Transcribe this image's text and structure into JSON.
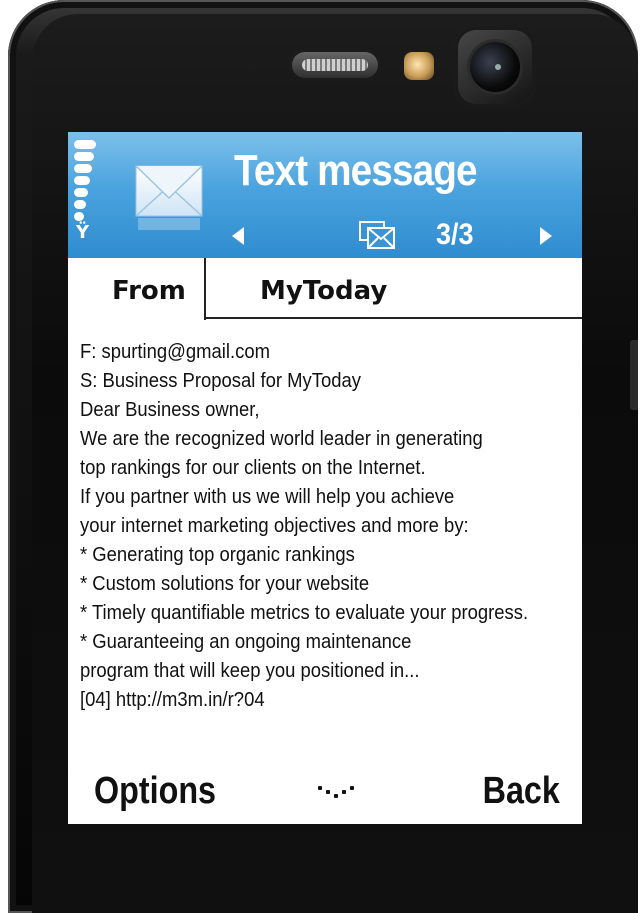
{
  "header": {
    "title": "Text message",
    "counter": "3/3"
  },
  "from_row": {
    "label": "From",
    "value": "MyToday"
  },
  "message": {
    "lines": [
      "F: spurting@gmail.com",
      "S: Business Proposal for MyToday",
      "Dear Business owner,",
      "We are the recognized world leader in generating",
      "top rankings for our clients on the Internet.",
      "If you partner with us we will help you achieve",
      "your internet marketing objectives and more by:",
      "* Generating top organic rankings",
      "* Custom solutions for your website",
      "* Timely quantifiable metrics to evaluate your progress.",
      "* Guaranteeing an ongoing maintenance",
      "program that will keep you positioned in...",
      "[04] http://m3m.in/r?04"
    ]
  },
  "softkeys": {
    "left": "Options",
    "right": "Back"
  },
  "colors": {
    "header_top": "#7cc0ea",
    "header_bottom": "#2f8ccf",
    "phone_body": "#0e0e0e",
    "text": "#111111"
  },
  "icons": {
    "signal": "signal-strength-icon",
    "envelope": "envelope-icon",
    "message_type": "multi-message-icon",
    "menu": "menu-dots-icon"
  }
}
